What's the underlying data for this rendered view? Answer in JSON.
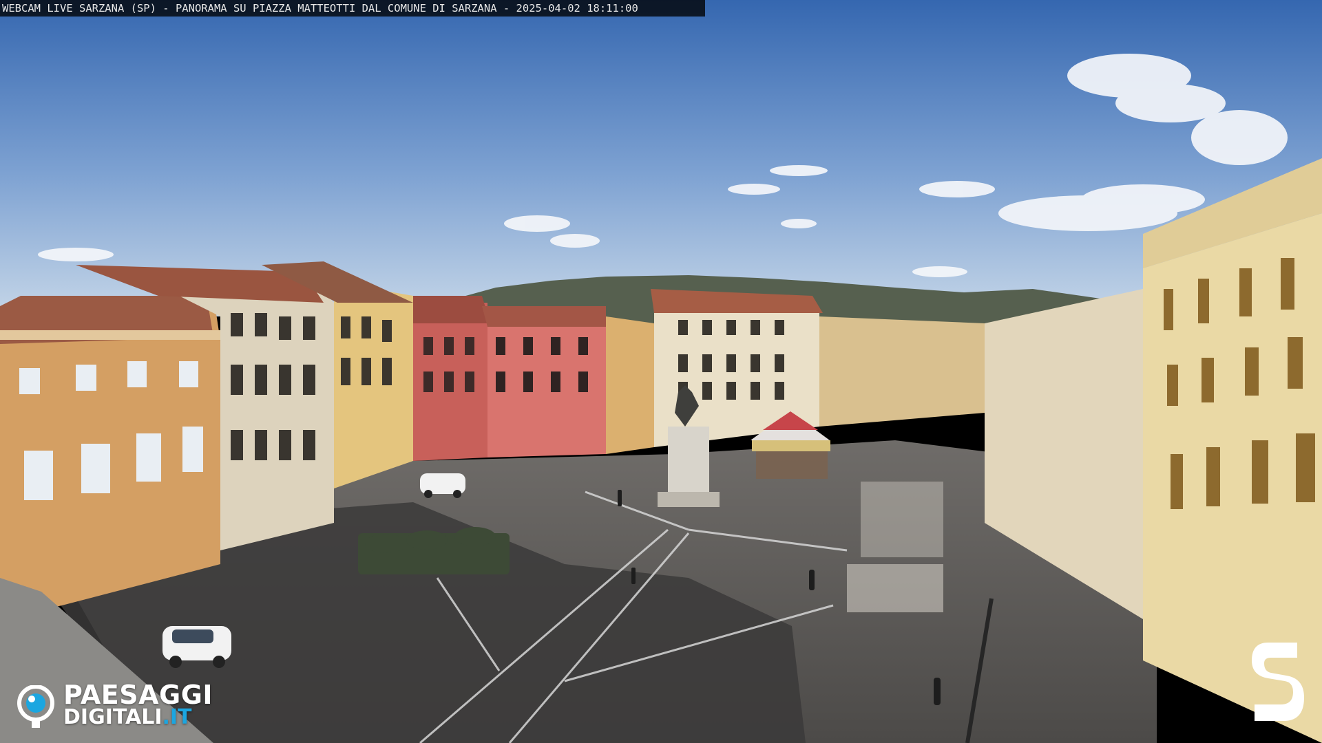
{
  "overlay": {
    "timestamp_text": "WEBCAM LIVE SARZANA (SP) - PANORAMA SU PIAZZA MATTEOTTI DAL COMUNE DI SARZANA - 2025-04-02  18:11:00"
  },
  "watermark": {
    "brand_line1": "PAESAGGI",
    "brand_line2_main": "DIGITALI",
    "brand_line2_tld": ".IT",
    "brand_icon": "eye-camera-icon",
    "brand_accent_color": "#1ba6e0",
    "corner_logo": "s-logo-icon"
  },
  "colors": {
    "sky_top": "#3b6fb6",
    "sky_bottom": "#b9cfe6",
    "plaza": "#5d5b5a",
    "shadow": "#3a3938",
    "facade_ochre": "#d9a66a",
    "facade_red": "#c9605a",
    "facade_cream": "#e6d7b4"
  }
}
